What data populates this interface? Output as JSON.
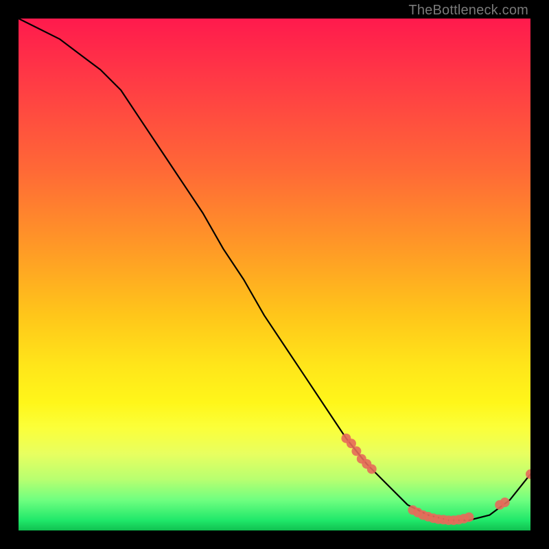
{
  "watermark": "TheBottleneck.com",
  "chart_data": {
    "type": "line",
    "title": "",
    "xlabel": "",
    "ylabel": "",
    "xlim": [
      0,
      100
    ],
    "ylim": [
      0,
      100
    ],
    "x": [
      0,
      4,
      8,
      12,
      16,
      20,
      24,
      28,
      32,
      36,
      40,
      44,
      48,
      52,
      56,
      60,
      64,
      68,
      72,
      76,
      80,
      84,
      88,
      92,
      96,
      100
    ],
    "values": [
      100,
      98,
      96,
      93,
      90,
      86,
      80,
      74,
      68,
      62,
      55,
      49,
      42,
      36,
      30,
      24,
      18,
      13,
      9,
      5,
      3,
      2,
      2,
      3,
      6,
      11
    ],
    "marker_points": [
      {
        "x": 64,
        "y": 18
      },
      {
        "x": 65,
        "y": 17
      },
      {
        "x": 66,
        "y": 15.5
      },
      {
        "x": 67,
        "y": 14
      },
      {
        "x": 68,
        "y": 13
      },
      {
        "x": 69,
        "y": 12
      },
      {
        "x": 77,
        "y": 4
      },
      {
        "x": 78,
        "y": 3.5
      },
      {
        "x": 79,
        "y": 3
      },
      {
        "x": 80,
        "y": 2.7
      },
      {
        "x": 81,
        "y": 2.4
      },
      {
        "x": 82,
        "y": 2.2
      },
      {
        "x": 83,
        "y": 2.1
      },
      {
        "x": 84,
        "y": 2
      },
      {
        "x": 85,
        "y": 2
      },
      {
        "x": 86,
        "y": 2.1
      },
      {
        "x": 87,
        "y": 2.3
      },
      {
        "x": 88,
        "y": 2.6
      },
      {
        "x": 94,
        "y": 5
      },
      {
        "x": 95,
        "y": 5.5
      },
      {
        "x": 100,
        "y": 11
      }
    ],
    "_value_note": "x and y are percentages of the plot area; data values are estimated from pixel positions since no axes/ticks are shown."
  }
}
